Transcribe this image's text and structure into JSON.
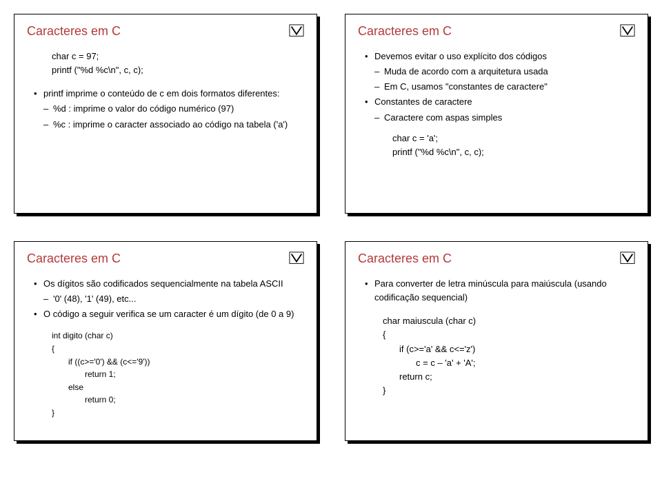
{
  "slides": {
    "tl": {
      "title": "Caracteres em C",
      "code1": "char c = 97;",
      "code2": "printf (\"%d %c\\n\", c, c);",
      "b1": "printf imprime o conteúdo de c em dois formatos diferentes:",
      "d1": "%d : imprime o valor do código numérico (97)",
      "d2": "%c : imprime o caracter associado ao código na tabela ('a')"
    },
    "tr": {
      "title": "Caracteres em C",
      "b1": "Devemos evitar o uso explícito dos códigos",
      "d1": "Muda de acordo com a arquitetura usada",
      "d2": "Em C, usamos \"constantes de caractere\"",
      "b2": "Constantes de caractere",
      "d3": "Caractere com aspas simples",
      "code1": "char c = 'a';",
      "code2": "printf (\"%d %c\\n\", c, c);"
    },
    "bl": {
      "title": "Caracteres em C",
      "b1": "Os dígitos são codificados sequencialmente na tabela ASCII",
      "d1": "'0' (48), '1' (49), etc...",
      "b2": "O código a seguir verifica se um caracter é um dígito (de 0 a 9)",
      "c1": "int digito (char c)",
      "c2": "{",
      "c3": "if ((c>='0') && (c<='9'))",
      "c4": "return 1;",
      "c5": "else",
      "c6": "return 0;",
      "c7": "}"
    },
    "br": {
      "title": "Caracteres em C",
      "b1": "Para converter de letra minúscula para maiúscula (usando codificação sequencial)",
      "c1": "char maiuscula (char c)",
      "c2": "{",
      "c3": "if (c>='a' && c<='z')",
      "c4": "c = c – 'a' + 'A';",
      "c5": "return c;",
      "c6": "}"
    }
  }
}
